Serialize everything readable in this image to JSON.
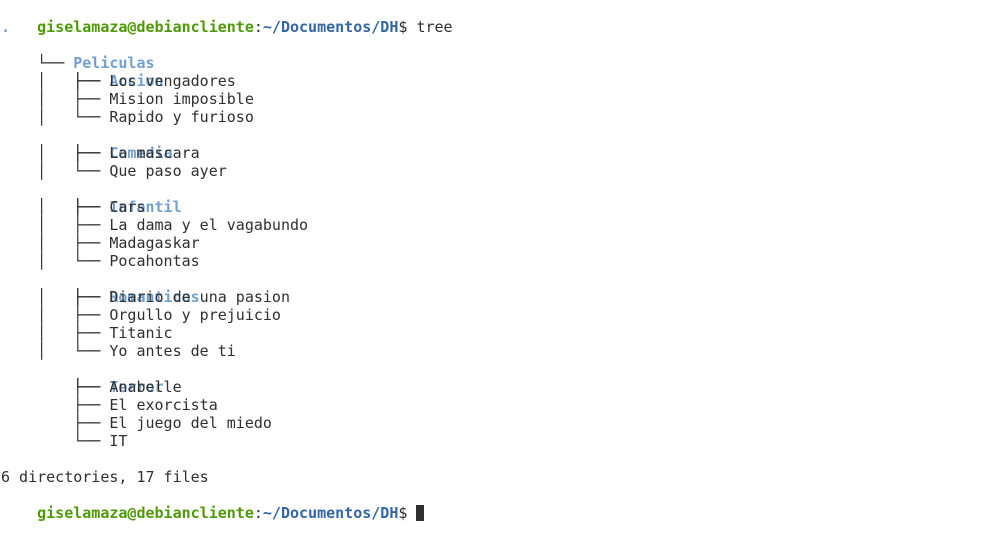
{
  "prompt": {
    "user_host": "giselamaza@debiancliente",
    "colon": ":",
    "path": "~/Documentos/DH",
    "symbol": "$ "
  },
  "command": "tree",
  "tree": {
    "dot": ".",
    "root": {
      "branch": "└── ",
      "name": "Peliculas"
    },
    "dirs": [
      {
        "branch": "    ├── ",
        "name": "Accion",
        "files": [
          {
            "branch": "    │   ├── ",
            "name": "Los vengadores"
          },
          {
            "branch": "    │   ├── ",
            "name": "Mision imposible"
          },
          {
            "branch": "    │   └── ",
            "name": "Rapido y furioso"
          }
        ]
      },
      {
        "branch": "    ├── ",
        "name": "Comedia",
        "files": [
          {
            "branch": "    │   ├── ",
            "name": "La mascara"
          },
          {
            "branch": "    │   └── ",
            "name": "Que paso ayer"
          }
        ]
      },
      {
        "branch": "    ├── ",
        "name": "Infantil",
        "files": [
          {
            "branch": "    │   ├── ",
            "name": "Cars"
          },
          {
            "branch": "    │   ├── ",
            "name": "La dama y el vagabundo"
          },
          {
            "branch": "    │   ├── ",
            "name": "Madagaskar"
          },
          {
            "branch": "    │   └── ",
            "name": "Pocahontas"
          }
        ]
      },
      {
        "branch": "    ├── ",
        "name": "Romanticas",
        "files": [
          {
            "branch": "    │   ├── ",
            "name": "Diario de una pasion"
          },
          {
            "branch": "    │   ├── ",
            "name": "Orgullo y prejuicio"
          },
          {
            "branch": "    │   ├── ",
            "name": "Titanic"
          },
          {
            "branch": "    │   └── ",
            "name": "Yo antes de ti"
          }
        ]
      },
      {
        "branch": "    └── ",
        "name": "Terror",
        "files": [
          {
            "branch": "        ├── ",
            "name": "Anabelle"
          },
          {
            "branch": "        ├── ",
            "name": "El exorcista"
          },
          {
            "branch": "        ├── ",
            "name": "El juego del miedo"
          },
          {
            "branch": "        └── ",
            "name": "IT"
          }
        ]
      }
    ]
  },
  "summary": "6 directories, 17 files",
  "colors": {
    "user": "#4e9a06",
    "path": "#3465a4",
    "directory": "#729fcf",
    "text": "#2f2f2f",
    "background": "#ffffff"
  }
}
